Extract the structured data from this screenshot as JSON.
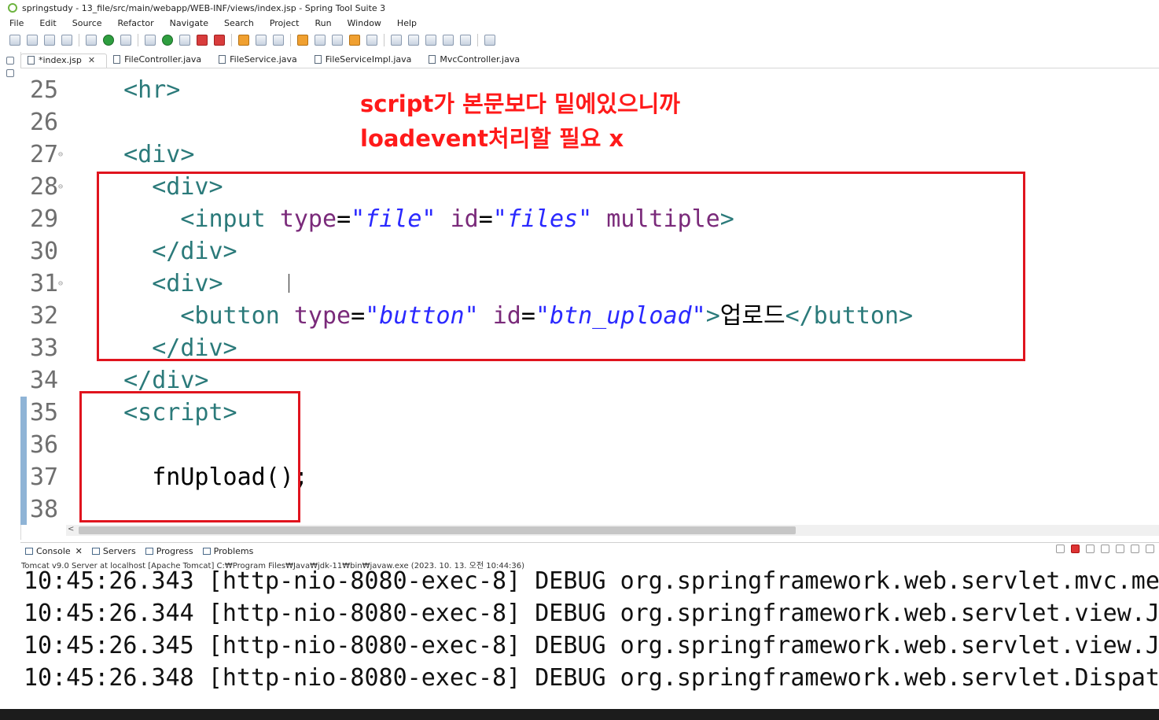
{
  "window": {
    "title": "springstudy - 13_file/src/main/webapp/WEB-INF/views/index.jsp - Spring Tool Suite 3"
  },
  "menu": [
    "File",
    "Edit",
    "Source",
    "Refactor",
    "Navigate",
    "Search",
    "Project",
    "Run",
    "Window",
    "Help"
  ],
  "tabs": [
    {
      "label": "*index.jsp",
      "active": true,
      "icon": "jsp-file-icon"
    },
    {
      "label": "FileController.java",
      "icon": "java-file-icon"
    },
    {
      "label": "FileService.java",
      "icon": "java-file-icon"
    },
    {
      "label": "FileServiceImpl.java",
      "icon": "java-file-icon"
    },
    {
      "label": "MvcController.java",
      "icon": "java-file-icon"
    }
  ],
  "editor": {
    "lines": [
      {
        "num": "25",
        "tokens": [
          [
            "tag",
            "  <hr>"
          ]
        ]
      },
      {
        "num": "26",
        "tokens": []
      },
      {
        "num": "27",
        "fold": true,
        "tokens": [
          [
            "tag",
            "  <div>"
          ]
        ]
      },
      {
        "num": "28",
        "fold": true,
        "tokens": [
          [
            "tag",
            "    <div>"
          ]
        ]
      },
      {
        "num": "29",
        "tokens": [
          [
            "tag",
            "      <input "
          ],
          [
            "attr",
            "type"
          ],
          [
            "txt",
            "="
          ],
          [
            "val",
            "\"file\""
          ],
          [
            "txt",
            " "
          ],
          [
            "attr",
            "id"
          ],
          [
            "txt",
            "="
          ],
          [
            "val",
            "\"files\""
          ],
          [
            "txt",
            " "
          ],
          [
            "attr",
            "multiple"
          ],
          [
            "tag",
            ">"
          ]
        ]
      },
      {
        "num": "30",
        "tokens": [
          [
            "tag",
            "    </div>"
          ]
        ]
      },
      {
        "num": "31",
        "fold": true,
        "tokens": [
          [
            "tag",
            "    <div>"
          ]
        ]
      },
      {
        "num": "32",
        "tokens": [
          [
            "tag",
            "      <button "
          ],
          [
            "attr",
            "type"
          ],
          [
            "txt",
            "="
          ],
          [
            "val",
            "\"button\""
          ],
          [
            "txt",
            " "
          ],
          [
            "attr",
            "id"
          ],
          [
            "txt",
            "="
          ],
          [
            "val",
            "\"btn_upload\""
          ],
          [
            "tag",
            ">"
          ],
          [
            "txt",
            "업로드"
          ],
          [
            "tag",
            "</button>"
          ]
        ]
      },
      {
        "num": "33",
        "tokens": [
          [
            "tag",
            "    </div>"
          ]
        ]
      },
      {
        "num": "34",
        "tokens": [
          [
            "tag",
            "  </div>"
          ]
        ]
      },
      {
        "num": "35",
        "changed": true,
        "tokens": [
          [
            "tag",
            "  <script>"
          ]
        ]
      },
      {
        "num": "36",
        "changed": true,
        "tokens": []
      },
      {
        "num": "37",
        "changed": true,
        "tokens": [
          [
            "txt",
            "    fnUpload();"
          ]
        ]
      },
      {
        "num": "38",
        "changed": true,
        "tokens": []
      }
    ]
  },
  "annotation": {
    "line1": "script가 본문보다 밑에있으니까",
    "line2": "loadevent처리할 필요 x",
    "color": "#ff1a1a"
  },
  "console": {
    "tabs": [
      "Console",
      "Servers",
      "Progress",
      "Problems"
    ],
    "description": "Tomcat v9.0 Server at localhost [Apache Tomcat] C:₩Program Files₩Java₩jdk-11₩bin₩javaw.exe  (2023. 10. 13. 오전 10:44:36)",
    "lines": [
      "10:45:26.343 [http-nio-8080-exec-8] DEBUG org.springframework.web.servlet.mvc.meth",
      "10:45:26.344 [http-nio-8080-exec-8] DEBUG org.springframework.web.servlet.view.Js",
      "10:45:26.345 [http-nio-8080-exec-8] DEBUG org.springframework.web.servlet.view.Js",
      "10:45:26.348 [http-nio-8080-exec-8] DEBUG org.springframework.web.servlet.Dispatc"
    ]
  },
  "colors": {
    "highlight_box": "#e0141e",
    "tag": "#2b7a7a",
    "attr": "#7a2a7a",
    "value": "#2a29ff"
  }
}
